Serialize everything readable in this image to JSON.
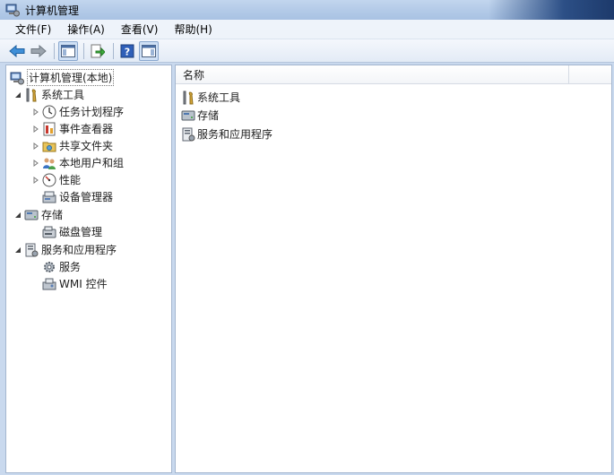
{
  "window": {
    "title": "计算机管理"
  },
  "menu": [
    {
      "label": "文件(F)"
    },
    {
      "label": "操作(A)"
    },
    {
      "label": "查看(V)"
    },
    {
      "label": "帮助(H)"
    }
  ],
  "toolbar": {
    "buttons": [
      "back-arrow-icon",
      "forward-arrow-icon",
      "show-hide-console-tree-icon",
      "export-list-icon",
      "help-icon",
      "show-hide-action-pane-icon"
    ]
  },
  "tree": {
    "root": "计算机管理(本地)",
    "system_tools": "系统工具",
    "task_scheduler": "任务计划程序",
    "event_viewer": "事件查看器",
    "shared_folders": "共享文件夹",
    "local_users": "本地用户和组",
    "performance": "性能",
    "device_manager": "设备管理器",
    "storage": "存储",
    "disk_management": "磁盘管理",
    "services_apps": "服务和应用程序",
    "services": "服务",
    "wmi": "WMI 控件"
  },
  "list": {
    "column_name": "名称",
    "items": [
      "系统工具",
      "存储",
      "服务和应用程序"
    ]
  },
  "colors": {
    "accent": "#2c4f86",
    "selection": "#cfe0f5"
  }
}
